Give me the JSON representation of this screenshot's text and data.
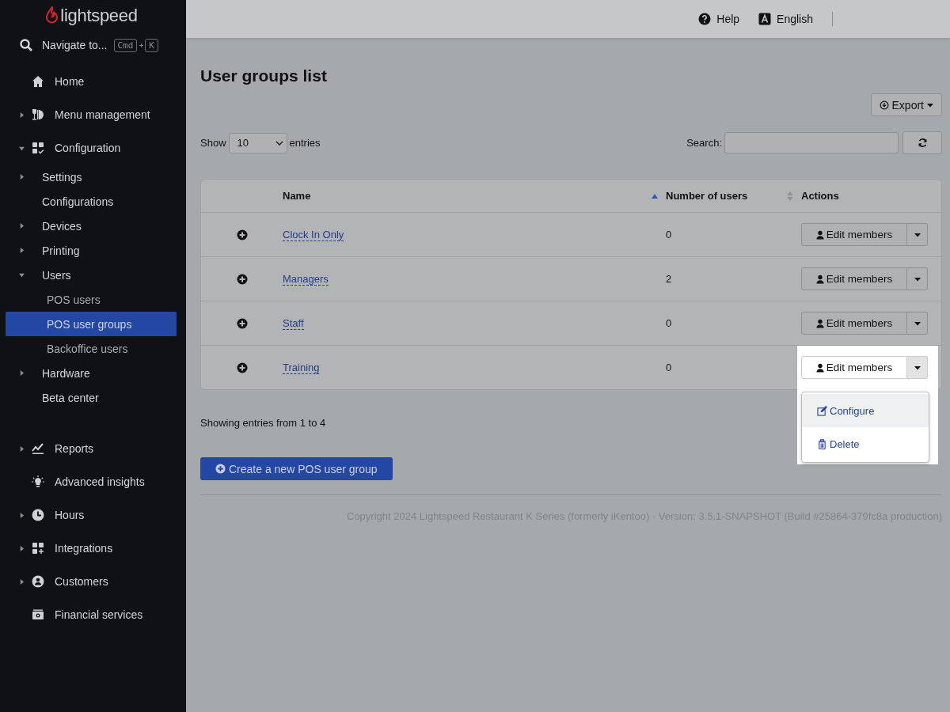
{
  "sidebar": {
    "logo": "lightspeed",
    "navigate": {
      "label": "Navigate to...",
      "keys": [
        "Cmd",
        "K"
      ],
      "plus": "+"
    },
    "items": [
      {
        "label": "Home",
        "selected": false
      },
      {
        "label": "Menu management",
        "expanded": false,
        "selected": false
      },
      {
        "label": "Configuration",
        "expanded": true,
        "selected": false,
        "children": [
          {
            "label": "Settings",
            "expanded": false,
            "selected": false
          },
          {
            "label": "Configurations",
            "selected": false
          },
          {
            "label": "Devices",
            "expanded": false,
            "selected": false
          },
          {
            "label": "Printing",
            "expanded": false,
            "selected": false
          },
          {
            "label": "Users",
            "expanded": true,
            "selected": false,
            "children": [
              {
                "label": "POS users",
                "selected": false
              },
              {
                "label": "POS user groups",
                "selected": true
              },
              {
                "label": "Backoffice users",
                "selected": false
              }
            ]
          },
          {
            "label": "Hardware",
            "expanded": false,
            "selected": false
          },
          {
            "label": "Beta center",
            "selected": false
          }
        ]
      },
      {
        "label": "Reports",
        "expanded": false,
        "selected": false
      },
      {
        "label": "Advanced insights",
        "selected": false
      },
      {
        "label": "Hours",
        "expanded": false,
        "selected": false
      },
      {
        "label": "Integrations",
        "expanded": false,
        "selected": false
      },
      {
        "label": "Customers",
        "expanded": false,
        "selected": false
      },
      {
        "label": "Financial services",
        "selected": false
      }
    ]
  },
  "top_bar": {
    "help": "Help",
    "language": "English"
  },
  "page": {
    "title": "User groups list",
    "export": "Export",
    "show_label": "Show",
    "entries_value": "10",
    "entries_label": "entries",
    "search_label": "Search:"
  },
  "table": {
    "columns": [
      {
        "label": "Name",
        "kind": "sorted"
      },
      {
        "label": "Number of users",
        "kind": "sortable"
      },
      {
        "label": "Actions",
        "kind": "plain"
      }
    ],
    "rows": [
      {
        "name": "Clock In Only",
        "users": "0",
        "action": "Edit members",
        "highlighted": false
      },
      {
        "name": "Managers",
        "users": "2",
        "action": "Edit members",
        "highlighted": false
      },
      {
        "name": "Staff",
        "users": "0",
        "action": "Edit members",
        "highlighted": false
      },
      {
        "name": "Training",
        "users": "0",
        "action": "Edit members",
        "highlighted": true,
        "menu": [
          {
            "label": "Configure",
            "selected": true
          },
          {
            "label": "Delete",
            "selected": false
          }
        ]
      }
    ]
  },
  "summary": "Showing entries from 1 to 4",
  "create_button": "Create a new POS user group",
  "footer": "Copyright 2024 Lightspeed Restaurant K Series (formerly iKentoo) - Version: 3.5.1-SNAPSHOT (Build #25864-379fc8a production)"
}
